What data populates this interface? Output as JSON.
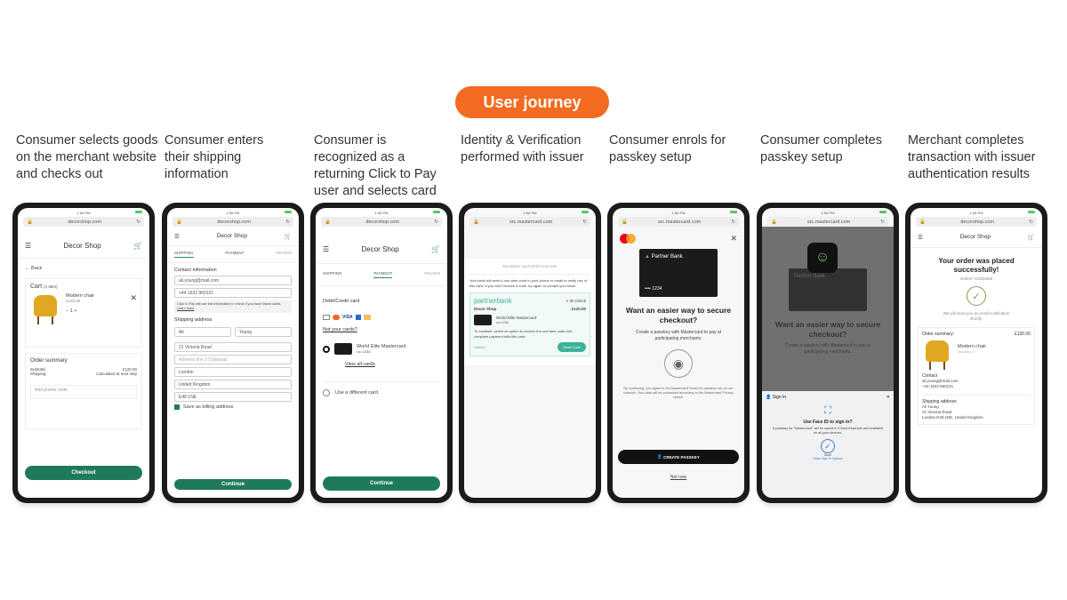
{
  "title": "User journey",
  "steps": [
    {
      "caption": "Consumer selects goods on the merchant website and checks out"
    },
    {
      "caption": "Consumer enters their shipping information"
    },
    {
      "caption": "Consumer is recognized as a returning Click to Pay user and selects card"
    },
    {
      "caption": "Identity & Verification performed with issuer"
    },
    {
      "caption": "Consumer enrols for passkey setup"
    },
    {
      "caption": "Consumer completes passkey setup"
    },
    {
      "caption": "Merchant completes transaction with issuer authentication results"
    }
  ],
  "common": {
    "time": "1:56 PM",
    "merchant_url": "decorshop.com",
    "mc_url": "src.mastercard.com",
    "shop": "Decor Shop",
    "product": "Modern chair",
    "price": "£120.00",
    "card_name": "World Elite Mastercard",
    "card_last4": "•••• 1234",
    "email": "ali.young@mail.com",
    "phone": "+44 1632 960121"
  },
  "s1": {
    "back": "← Back",
    "cart": "Cart",
    "items": "(1 item)",
    "qty": "1",
    "order_summary": "Order summary",
    "subtotal_label": "Subtotal:",
    "shipping_label": "Shipping:",
    "shipping_value": "Calculated at next step",
    "promo_placeholder": "Add promo code",
    "checkout": "Checkout"
  },
  "s2": {
    "tabs": [
      "SHIPPING",
      "PAYMENT",
      "REVIEW"
    ],
    "contact": "Contact information",
    "note": "Click to Pay will use this information to check if you have linked cards.",
    "learn_more": "Learn more",
    "shipping_address": "Shipping address",
    "first": "Ali",
    "last": "Young",
    "addr1": "21 Victoria Road",
    "addr2_placeholder": "Address line 2 (Optional)",
    "city": "London",
    "country": "United Kingdom",
    "postcode": "E48 1NE",
    "save_billing": "Save as billing address",
    "continue": "Continue"
  },
  "s3": {
    "debit_credit": "Debit/Credit card",
    "not_your_cards": "Not your cards?",
    "view_all": "View all cards",
    "different": "Use a different card",
    "continue": "Continue"
  },
  "s4": {
    "heading": "PAYMENT AUTHENTICATION",
    "intro": "Your bank will send a one-time code to your phone or email to verify use of this card. If you don't receive a code, try again or contact your bank.",
    "bank": "partnerbank",
    "id_check": "ID Check",
    "instruction": "To continue, select an option to receive the one-time code and complete payment with this card.",
    "cancel": "Cancel",
    "send_code": "Send Code"
  },
  "s5": {
    "bank": "Partner Bank",
    "heading": "Want an easier way to secure checkout?",
    "sub": "Create a passkey with Mastercard to pay at participating merchants.",
    "legal": "By continuing, you agree to the Mastercard Terms for passkey use on our network. Your data will be processed according to the Mastercard Privacy Notice.",
    "create": "CREATE PASSKEY",
    "not_now": "Not now"
  },
  "s6": {
    "sign_in": "Sign In",
    "faceid_q": "Use Face ID to sign in?",
    "faceid_desc": "A passkey for \"Mastercard\" will be saved in iCloud Keychain and available on all your devices.",
    "done": "Done",
    "other": "Other Sign In Options"
  },
  "s7": {
    "success": "Your order was placed successfully!",
    "order_no": "Order#: 01203450",
    "email_note": "We will send you an email notification shortly.",
    "order_summary": "Order summary:",
    "quantity": "Quantity: 1",
    "contact": "Contact",
    "shipping_address": "Shipping address",
    "name": "Ali Young",
    "addr1": "21 Victoria Road",
    "addr2": "London E48 1NE, United Kingdom"
  },
  "colors": {
    "accent": "#f26b21",
    "green": "#1f7a5c",
    "teal": "#3bb39a"
  }
}
